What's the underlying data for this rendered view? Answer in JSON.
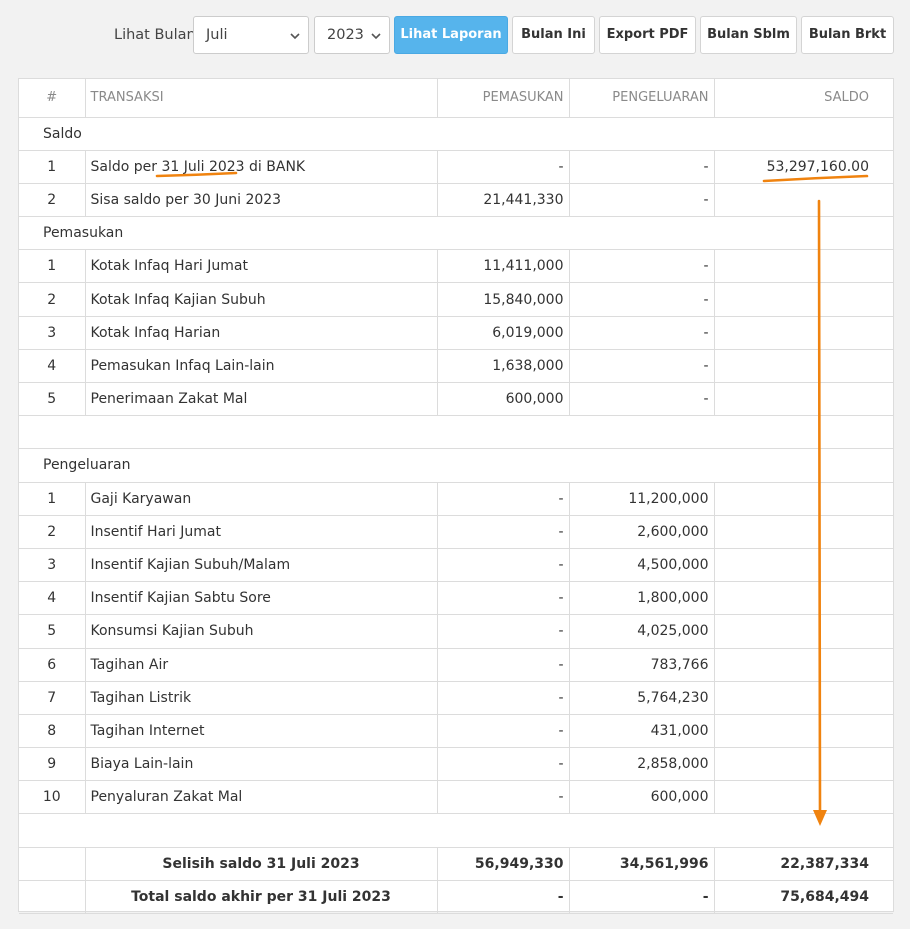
{
  "toolbar": {
    "label": "Lihat Bulan",
    "month_value": "Juli",
    "year_value": "2023",
    "view_report": "Lihat Laporan",
    "this_month": "Bulan Ini",
    "export_pdf": "Export PDF",
    "prev_month": "Bulan Sblm",
    "next_month": "Bulan Brkt"
  },
  "table": {
    "headers": [
      "#",
      "TRANSAKSI",
      "PEMASUKAN",
      "PENGELUARAN",
      "SALDO"
    ],
    "saldo_section": "Saldo",
    "saldo_rows": [
      [
        "1",
        "Saldo per 31 Juli 2023 di BANK",
        "-",
        "-",
        "53,297,160.00"
      ],
      [
        "2",
        "Sisa saldo per 30 Juni 2023",
        "21,441,330",
        "-",
        ""
      ]
    ],
    "income_section": "Pemasukan",
    "income_rows": [
      [
        "1",
        "Kotak Infaq Hari Jumat",
        "11,411,000",
        "-",
        ""
      ],
      [
        "2",
        "Kotak Infaq Kajian Subuh",
        "15,840,000",
        "-",
        ""
      ],
      [
        "3",
        "Kotak Infaq Harian",
        "6,019,000",
        "-",
        ""
      ],
      [
        "4",
        "Pemasukan Infaq Lain-lain",
        "1,638,000",
        "-",
        ""
      ],
      [
        "5",
        "Penerimaan Zakat Mal",
        "600,000",
        "-",
        ""
      ]
    ],
    "expense_section": "Pengeluaran",
    "expense_rows": [
      [
        "1",
        "Gaji Karyawan",
        "-",
        "11,200,000",
        ""
      ],
      [
        "2",
        "Insentif Hari Jumat",
        "-",
        "2,600,000",
        ""
      ],
      [
        "3",
        "Insentif Kajian Subuh/Malam",
        "-",
        "4,500,000",
        ""
      ],
      [
        "4",
        "Insentif Kajian Sabtu Sore",
        "-",
        "1,800,000",
        ""
      ],
      [
        "5",
        "Konsumsi Kajian Subuh",
        "-",
        "4,025,000",
        ""
      ],
      [
        "6",
        "Tagihan Air",
        "-",
        "783,766",
        ""
      ],
      [
        "7",
        "Tagihan Listrik",
        "-",
        "5,764,230",
        ""
      ],
      [
        "8",
        "Tagihan Internet",
        "-",
        "431,000",
        ""
      ],
      [
        "9",
        "Biaya Lain-lain",
        "-",
        "2,858,000",
        ""
      ],
      [
        "10",
        "Penyaluran Zakat Mal",
        "-",
        "600,000",
        ""
      ]
    ],
    "totals": [
      [
        "",
        "Selisih saldo 31 Juli 2023",
        "56,949,330",
        "34,561,996",
        "22,387,334"
      ],
      [
        "",
        "Total saldo akhir per 31 Juli 2023",
        "-",
        "-",
        "75,684,494"
      ]
    ]
  },
  "colors": {
    "primary_button": "#56b4ec",
    "annotation": "#f0830f"
  }
}
